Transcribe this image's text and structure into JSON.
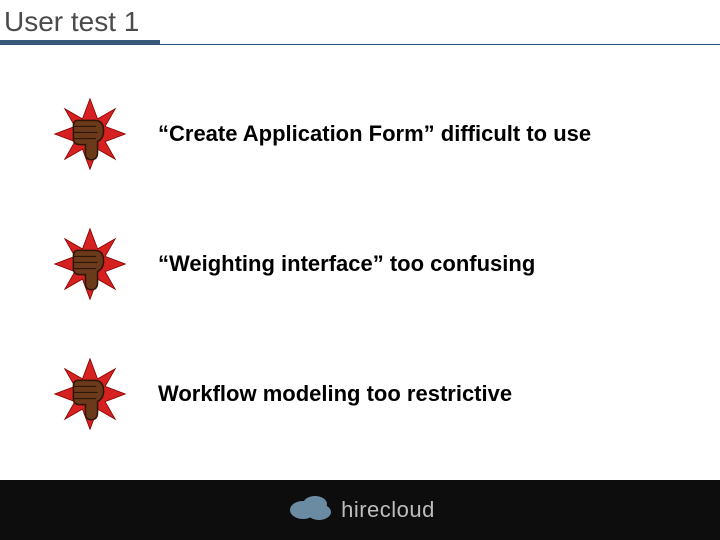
{
  "title": "User test 1",
  "items": [
    {
      "text": "“Create Application Form” difficult to use"
    },
    {
      "text": "“Weighting interface” too confusing"
    },
    {
      "text": "Workflow modeling too restrictive"
    }
  ],
  "footer": {
    "brand": "hirecloud"
  },
  "colors": {
    "title_rule": "#39597a",
    "footer_bg": "#0d0d0d",
    "cloud": "#6b8ba3",
    "starburst": "#d62121",
    "thumb": "#6a3a1a"
  }
}
